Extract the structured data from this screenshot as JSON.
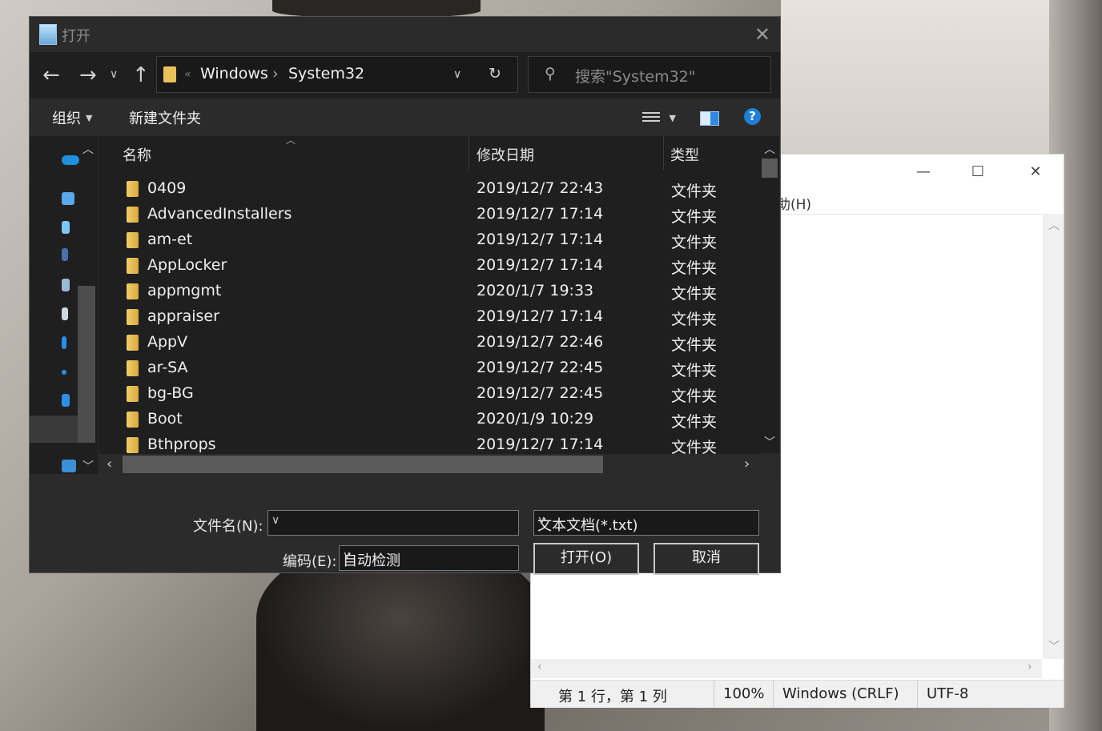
{
  "notepad": {
    "menu_help": "帮助(H)",
    "status": {
      "position": "第 1 行，第 1 列",
      "zoom": "100%",
      "eol": "Windows (CRLF)",
      "encoding": "UTF-8"
    }
  },
  "dialog": {
    "title": "打开",
    "address": {
      "overflow": "«",
      "crumb1": "Windows",
      "sep": "›",
      "crumb2": "System32"
    },
    "search_placeholder": "搜索\"System32\"",
    "toolbar": {
      "organize": "组织",
      "new_folder": "新建文件夹"
    },
    "columns": {
      "name": "名称",
      "modified": "修改日期",
      "type": "类型"
    },
    "files": [
      {
        "name": "0409",
        "date": "2019/12/7 22:43",
        "type": "文件夹"
      },
      {
        "name": "AdvancedInstallers",
        "date": "2019/12/7 17:14",
        "type": "文件夹"
      },
      {
        "name": "am-et",
        "date": "2019/12/7 17:14",
        "type": "文件夹"
      },
      {
        "name": "AppLocker",
        "date": "2019/12/7 17:14",
        "type": "文件夹"
      },
      {
        "name": "appmgmt",
        "date": "2020/1/7 19:33",
        "type": "文件夹"
      },
      {
        "name": "appraiser",
        "date": "2019/12/7 17:14",
        "type": "文件夹"
      },
      {
        "name": "AppV",
        "date": "2019/12/7 22:46",
        "type": "文件夹"
      },
      {
        "name": "ar-SA",
        "date": "2019/12/7 22:45",
        "type": "文件夹"
      },
      {
        "name": "bg-BG",
        "date": "2019/12/7 22:45",
        "type": "文件夹"
      },
      {
        "name": "Boot",
        "date": "2020/1/9 10:29",
        "type": "文件夹"
      },
      {
        "name": "Bthprops",
        "date": "2019/12/7 17:14",
        "type": "文件夹"
      }
    ],
    "filename_label": "文件名(N):",
    "filename_value": "",
    "filter": "文本文档(*.txt)",
    "encoding_label": "编码(E):",
    "encoding_value": "自动检测",
    "open_button": "打开(O)",
    "cancel_button": "取消"
  }
}
